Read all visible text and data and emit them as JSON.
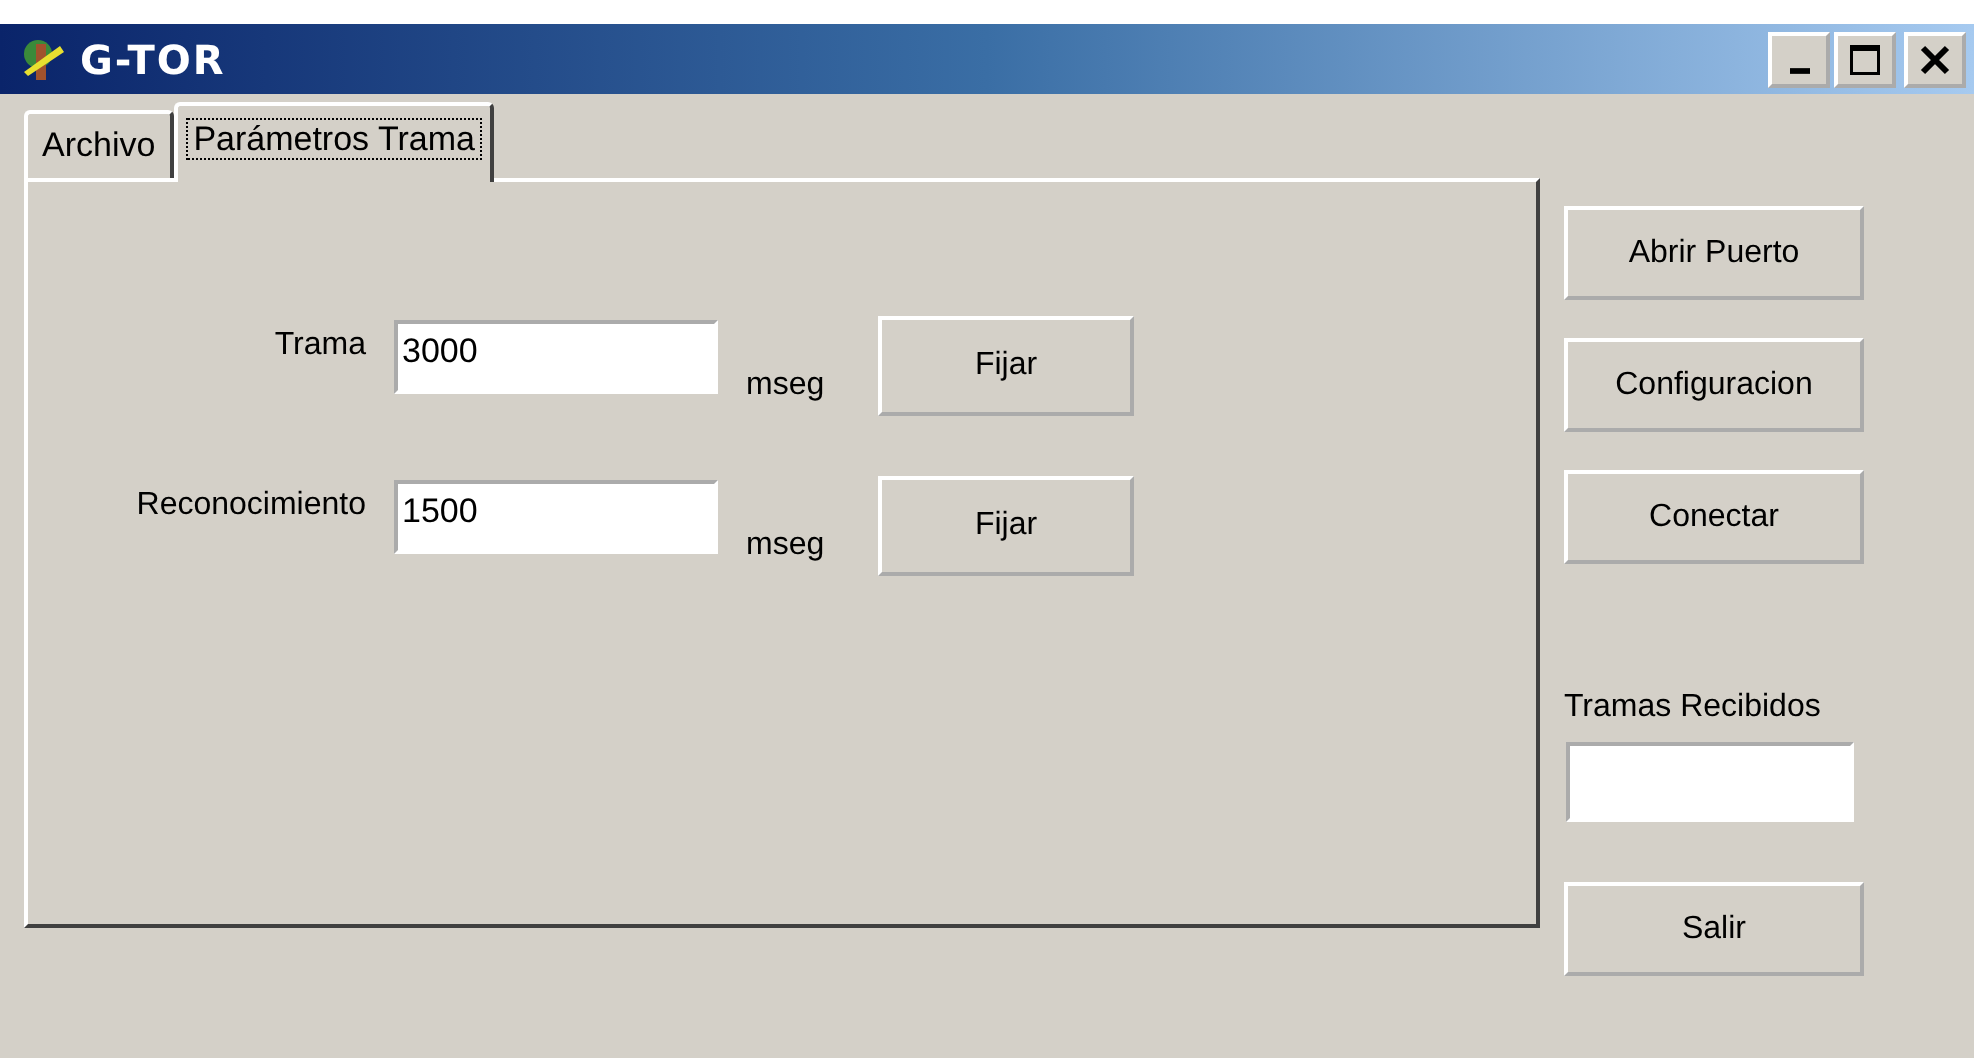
{
  "window": {
    "title": "G-TOR"
  },
  "tabs": [
    {
      "label": "Archivo",
      "selected": false
    },
    {
      "label": "Parámetros Trama",
      "selected": true
    }
  ],
  "form": {
    "rows": [
      {
        "label": "Trama",
        "value": "3000",
        "unit": "mseg",
        "button": "Fijar"
      },
      {
        "label": "Reconocimiento",
        "value": "1500",
        "unit": "mseg",
        "button": "Fijar"
      }
    ]
  },
  "side": {
    "buttons": [
      "Abrir Puerto",
      "Configuracion",
      "Conectar"
    ],
    "received": {
      "label": "Tramas Recibidos"
    },
    "exit_button": "Salir"
  }
}
